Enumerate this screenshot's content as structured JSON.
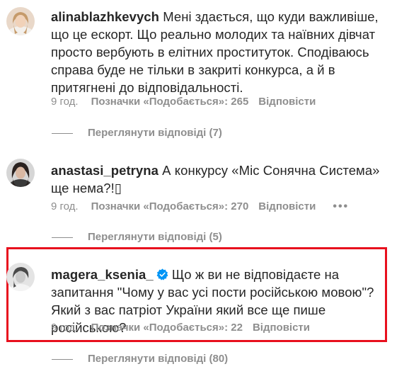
{
  "comments": [
    {
      "username": "alinablazhkevych",
      "text": "Мені здається, що куди важливіше, що це ескорт. Що реально молодих та наївних дівчат просто вербують в елітних проституток. Сподіваюсь справа буде не тільки в закриті конкурса, а й в притягнені до відповідальності.",
      "time": "9 год.",
      "likes": "Позначки «Подобається»: 265",
      "reply": "Відповісти",
      "view_replies": "Переглянути відповіді (7)"
    },
    {
      "username": "anastasi_petryna",
      "text": "А конкурсу «Міс Сонячна Система» ще нема?!▯",
      "time": "9 год.",
      "likes": "Позначки «Подобається»: 270",
      "reply": "Відповісти",
      "more": "•••",
      "view_replies": "Переглянути відповіді (5)"
    },
    {
      "username": "magera_ksenia_",
      "verified": true,
      "text": "Що ж ви не відповідаєте на запитання \"Чому у вас усі пости російською мовою\"? Який з вас патріот України який все ще пише російською?",
      "time": "9 год.",
      "likes": "Позначки «Подобається»: 22",
      "reply": "Відповісти",
      "view_replies": "Переглянути відповіді (80)"
    }
  ],
  "colors": {
    "text": "#262626",
    "secondary": "#8e8e8e",
    "verified": "#0095f6",
    "highlight_border": "#e8101e"
  }
}
